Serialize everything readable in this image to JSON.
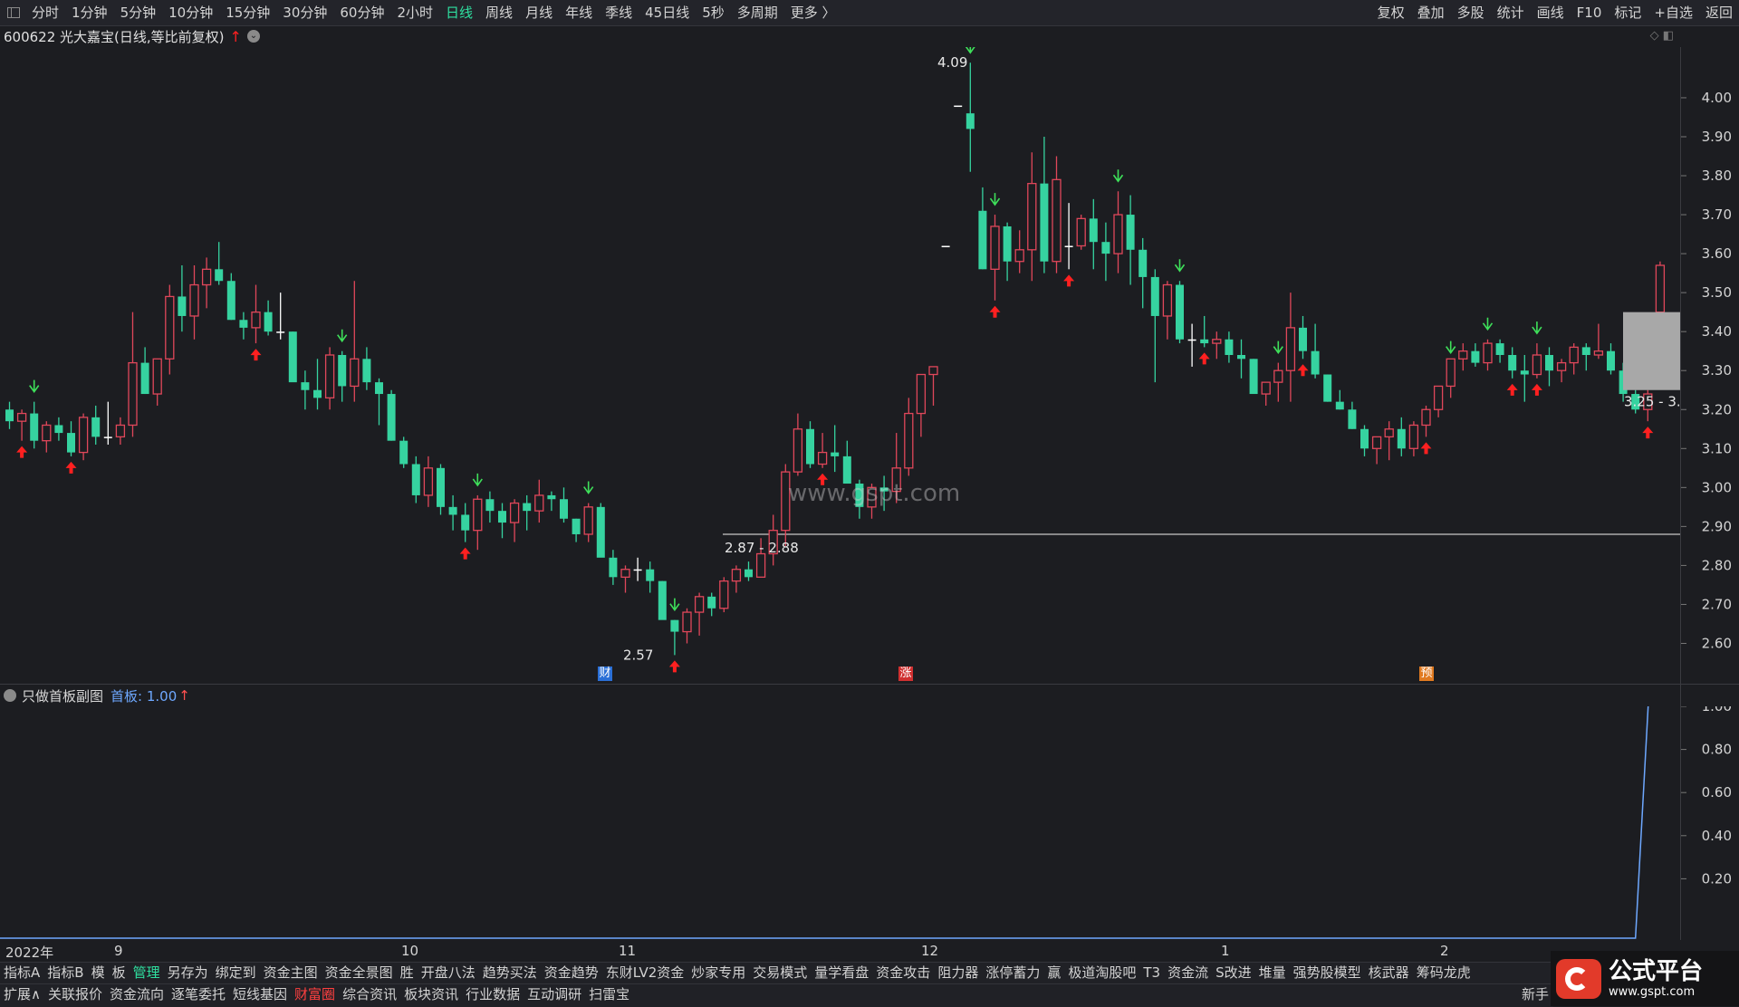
{
  "topbar": {
    "periods": [
      "分时",
      "1分钟",
      "5分钟",
      "10分钟",
      "15分钟",
      "30分钟",
      "60分钟",
      "2小时",
      "日线",
      "周线",
      "月线",
      "年线",
      "季线",
      "45日线",
      "5秒",
      "多周期",
      "更多 〉"
    ],
    "active": "日线",
    "right_tools": [
      "复权",
      "叠加",
      "多股",
      "统计",
      "画线",
      "F10",
      "标记",
      "+自选",
      "返回"
    ]
  },
  "stock": {
    "title": "600622 光大嘉宝(日线,等比前复权)",
    "up_arrow": "↑",
    "dropdown": "⌄"
  },
  "corner_icons": "◇ ◧",
  "price_axis": {
    "labels": [
      "4.00",
      "3.90",
      "3.80",
      "3.70",
      "3.60",
      "3.50",
      "3.40",
      "3.30",
      "3.20",
      "3.10",
      "3.00",
      "2.90",
      "2.80",
      "2.70",
      "2.60"
    ]
  },
  "annotations": {
    "high": "4.09",
    "low": "2.57",
    "range1": "2.87 - 2.88",
    "range2": "3.25 - 3.",
    "watermark": "www.gspt.com",
    "event_tags": [
      "财",
      "涨",
      "预"
    ]
  },
  "indicator": {
    "name": "只做首板副图",
    "label": "首板: 1.00",
    "arrow": "↑",
    "axis": [
      "1.00",
      "0.80",
      "0.60",
      "0.40",
      "0.20"
    ]
  },
  "dates": [
    "2022年",
    "9",
    "10",
    "11",
    "12",
    "1",
    "2"
  ],
  "toolbar1": [
    "指标A",
    "指标B",
    "模",
    "板",
    "管理",
    "另存为",
    "绑定到",
    "资金主图",
    "资金全景图",
    "胜",
    "开盘八法",
    "趋势买法",
    "资金趋势",
    "东财LV2资金",
    "炒家专用",
    "交易模式",
    "量学看盘",
    "资金攻击",
    "阻力器",
    "涨停蓄力",
    "赢",
    "极道淘股吧",
    "T3",
    "资金流",
    "S改进",
    "堆量",
    "强势股模型",
    "核武器",
    "筹码龙虎"
  ],
  "toolbar1_active": "管理",
  "toolbar2": [
    "扩展∧",
    "关联报价",
    "资金流向",
    "逐笔委托",
    "短线基因",
    "财富圈",
    "综合资讯",
    "板块资讯",
    "行业数据",
    "互动调研",
    "扫雷宝"
  ],
  "toolbar2_red": "财富圈",
  "newbie": "新手",
  "logo": {
    "main": "公式平台",
    "sub": "www.gspt.com"
  },
  "colors": {
    "up": "#e0475a",
    "down": "#36d3a0",
    "up_arrow": "#ff2020",
    "down_arrow": "#3ee05a",
    "line": "#6ea8ff"
  },
  "chart_data": {
    "type": "candlestick",
    "price_range": [
      2.55,
      4.13
    ],
    "highlight_level": 2.88,
    "candles": [
      [
        3.2,
        3.22,
        3.15,
        3.17
      ],
      [
        3.17,
        3.2,
        3.12,
        3.19
      ],
      [
        3.19,
        3.22,
        3.1,
        3.12
      ],
      [
        3.12,
        3.17,
        3.09,
        3.16
      ],
      [
        3.16,
        3.18,
        3.12,
        3.14
      ],
      [
        3.14,
        3.17,
        3.08,
        3.09
      ],
      [
        3.09,
        3.19,
        3.07,
        3.18
      ],
      [
        3.18,
        3.21,
        3.11,
        3.13
      ],
      [
        3.13,
        3.22,
        3.11,
        3.13
      ],
      [
        3.13,
        3.18,
        3.11,
        3.16
      ],
      [
        3.16,
        3.45,
        3.13,
        3.32
      ],
      [
        3.32,
        3.36,
        3.24,
        3.24
      ],
      [
        3.24,
        3.33,
        3.21,
        3.33
      ],
      [
        3.33,
        3.52,
        3.29,
        3.49
      ],
      [
        3.49,
        3.57,
        3.4,
        3.44
      ],
      [
        3.44,
        3.57,
        3.38,
        3.52
      ],
      [
        3.52,
        3.59,
        3.46,
        3.56
      ],
      [
        3.56,
        3.63,
        3.52,
        3.53
      ],
      [
        3.53,
        3.55,
        3.43,
        3.43
      ],
      [
        3.43,
        3.45,
        3.38,
        3.41
      ],
      [
        3.41,
        3.52,
        3.37,
        3.45
      ],
      [
        3.45,
        3.48,
        3.39,
        3.4
      ],
      [
        3.4,
        3.5,
        3.38,
        3.4
      ],
      [
        3.4,
        3.4,
        3.3,
        3.27
      ],
      [
        3.27,
        3.3,
        3.2,
        3.25
      ],
      [
        3.25,
        3.33,
        3.2,
        3.23
      ],
      [
        3.23,
        3.36,
        3.2,
        3.34
      ],
      [
        3.34,
        3.35,
        3.22,
        3.26
      ],
      [
        3.26,
        3.53,
        3.22,
        3.33
      ],
      [
        3.33,
        3.36,
        3.25,
        3.27
      ],
      [
        3.27,
        3.28,
        3.16,
        3.24
      ],
      [
        3.24,
        3.25,
        3.12,
        3.12
      ],
      [
        3.12,
        3.13,
        3.05,
        3.06
      ],
      [
        3.06,
        3.08,
        2.96,
        2.98
      ],
      [
        2.98,
        3.08,
        2.95,
        3.05
      ],
      [
        3.05,
        3.06,
        2.93,
        2.95
      ],
      [
        2.95,
        2.98,
        2.89,
        2.93
      ],
      [
        2.93,
        2.96,
        2.86,
        2.89
      ],
      [
        2.89,
        2.98,
        2.84,
        2.97
      ],
      [
        2.97,
        2.99,
        2.91,
        2.94
      ],
      [
        2.94,
        2.96,
        2.87,
        2.91
      ],
      [
        2.91,
        2.97,
        2.86,
        2.96
      ],
      [
        2.96,
        2.98,
        2.89,
        2.94
      ],
      [
        2.94,
        3.02,
        2.91,
        2.98
      ],
      [
        2.98,
        2.99,
        2.94,
        2.97
      ],
      [
        2.97,
        3.0,
        2.91,
        2.92
      ],
      [
        2.92,
        2.92,
        2.86,
        2.88
      ],
      [
        2.88,
        2.96,
        2.86,
        2.95
      ],
      [
        2.95,
        2.96,
        2.83,
        2.82
      ],
      [
        2.82,
        2.84,
        2.75,
        2.77
      ],
      [
        2.77,
        2.8,
        2.73,
        2.79
      ],
      [
        2.79,
        2.82,
        2.76,
        2.79
      ],
      [
        2.79,
        2.81,
        2.73,
        2.76
      ],
      [
        2.76,
        2.76,
        2.68,
        2.66
      ],
      [
        2.66,
        2.66,
        2.57,
        2.63
      ],
      [
        2.63,
        2.69,
        2.6,
        2.68
      ],
      [
        2.68,
        2.73,
        2.62,
        2.72
      ],
      [
        2.72,
        2.73,
        2.67,
        2.69
      ],
      [
        2.69,
        2.77,
        2.68,
        2.76
      ],
      [
        2.76,
        2.8,
        2.73,
        2.79
      ],
      [
        2.79,
        2.81,
        2.76,
        2.77
      ],
      [
        2.77,
        2.87,
        2.77,
        2.83
      ],
      [
        2.83,
        2.93,
        2.8,
        2.89
      ],
      [
        2.89,
        3.06,
        2.85,
        3.04
      ],
      [
        3.04,
        3.19,
        3.03,
        3.15
      ],
      [
        3.15,
        3.17,
        3.05,
        3.06
      ],
      [
        3.06,
        3.14,
        3.05,
        3.09
      ],
      [
        3.09,
        3.16,
        3.04,
        3.08
      ],
      [
        3.08,
        3.12,
        3.03,
        3.01
      ],
      [
        3.01,
        3.02,
        2.92,
        2.95
      ],
      [
        2.95,
        3.01,
        2.92,
        3.0
      ],
      [
        3.0,
        3.03,
        2.94,
        2.99
      ],
      [
        2.99,
        3.14,
        2.96,
        3.05
      ],
      [
        3.05,
        3.23,
        3.03,
        3.19
      ],
      [
        3.19,
        3.27,
        3.13,
        3.29
      ],
      [
        3.29,
        3.31,
        3.21,
        3.31
      ],
      [
        3.62,
        3.62,
        3.62,
        3.62
      ],
      [
        3.98,
        3.98,
        3.98,
        3.98
      ],
      [
        3.96,
        4.09,
        3.81,
        3.92
      ],
      [
        3.71,
        3.77,
        3.56,
        3.56
      ],
      [
        3.56,
        3.7,
        3.48,
        3.67
      ],
      [
        3.67,
        3.68,
        3.53,
        3.58
      ],
      [
        3.58,
        3.66,
        3.55,
        3.61
      ],
      [
        3.61,
        3.86,
        3.53,
        3.78
      ],
      [
        3.78,
        3.9,
        3.55,
        3.58
      ],
      [
        3.58,
        3.85,
        3.55,
        3.79
      ],
      [
        3.62,
        3.73,
        3.56,
        3.62
      ],
      [
        3.62,
        3.7,
        3.61,
        3.69
      ],
      [
        3.69,
        3.74,
        3.56,
        3.63
      ],
      [
        3.63,
        3.68,
        3.53,
        3.6
      ],
      [
        3.6,
        3.76,
        3.55,
        3.7
      ],
      [
        3.7,
        3.75,
        3.52,
        3.61
      ],
      [
        3.61,
        3.64,
        3.46,
        3.54
      ],
      [
        3.54,
        3.56,
        3.27,
        3.44
      ],
      [
        3.44,
        3.53,
        3.38,
        3.52
      ],
      [
        3.52,
        3.53,
        3.37,
        3.38
      ],
      [
        3.38,
        3.42,
        3.31,
        3.38
      ],
      [
        3.38,
        3.44,
        3.36,
        3.37
      ],
      [
        3.37,
        3.4,
        3.33,
        3.38
      ],
      [
        3.38,
        3.4,
        3.32,
        3.34
      ],
      [
        3.34,
        3.38,
        3.28,
        3.33
      ],
      [
        3.33,
        3.33,
        3.25,
        3.24
      ],
      [
        3.24,
        3.27,
        3.21,
        3.27
      ],
      [
        3.27,
        3.32,
        3.22,
        3.3
      ],
      [
        3.3,
        3.5,
        3.22,
        3.41
      ],
      [
        3.41,
        3.44,
        3.33,
        3.35
      ],
      [
        3.35,
        3.42,
        3.28,
        3.29
      ],
      [
        3.29,
        3.29,
        3.22,
        3.22
      ],
      [
        3.22,
        3.25,
        3.2,
        3.2
      ],
      [
        3.2,
        3.22,
        3.15,
        3.15
      ],
      [
        3.15,
        3.16,
        3.08,
        3.1
      ],
      [
        3.1,
        3.12,
        3.06,
        3.13
      ],
      [
        3.13,
        3.17,
        3.07,
        3.15
      ],
      [
        3.15,
        3.18,
        3.08,
        3.1
      ],
      [
        3.1,
        3.17,
        3.08,
        3.16
      ],
      [
        3.16,
        3.21,
        3.13,
        3.2
      ],
      [
        3.2,
        3.26,
        3.18,
        3.26
      ],
      [
        3.26,
        3.32,
        3.23,
        3.33
      ],
      [
        3.33,
        3.37,
        3.3,
        3.35
      ],
      [
        3.35,
        3.37,
        3.31,
        3.32
      ],
      [
        3.32,
        3.38,
        3.3,
        3.37
      ],
      [
        3.37,
        3.38,
        3.32,
        3.34
      ],
      [
        3.34,
        3.36,
        3.28,
        3.3
      ],
      [
        3.3,
        3.34,
        3.22,
        3.29
      ],
      [
        3.29,
        3.37,
        3.28,
        3.34
      ],
      [
        3.34,
        3.36,
        3.26,
        3.3
      ],
      [
        3.3,
        3.33,
        3.27,
        3.32
      ],
      [
        3.32,
        3.37,
        3.29,
        3.36
      ],
      [
        3.36,
        3.37,
        3.3,
        3.34
      ],
      [
        3.34,
        3.42,
        3.33,
        3.35
      ],
      [
        3.35,
        3.37,
        3.29,
        3.3
      ],
      [
        3.3,
        3.32,
        3.22,
        3.24
      ],
      [
        3.24,
        3.25,
        3.19,
        3.2
      ],
      [
        3.2,
        3.25,
        3.17,
        3.24
      ],
      [
        3.45,
        3.58,
        3.45,
        3.57
      ]
    ],
    "down_arrows": [
      2,
      27,
      38,
      47,
      54,
      78,
      80,
      90,
      95,
      103,
      117,
      120,
      124
    ],
    "up_arrows": [
      1,
      5,
      20,
      37,
      54,
      66,
      80,
      86,
      97,
      105,
      115,
      122,
      124,
      133
    ],
    "indicator_series": {
      "name": "首板",
      "flat_until": 132,
      "final_value": 1.0
    }
  }
}
